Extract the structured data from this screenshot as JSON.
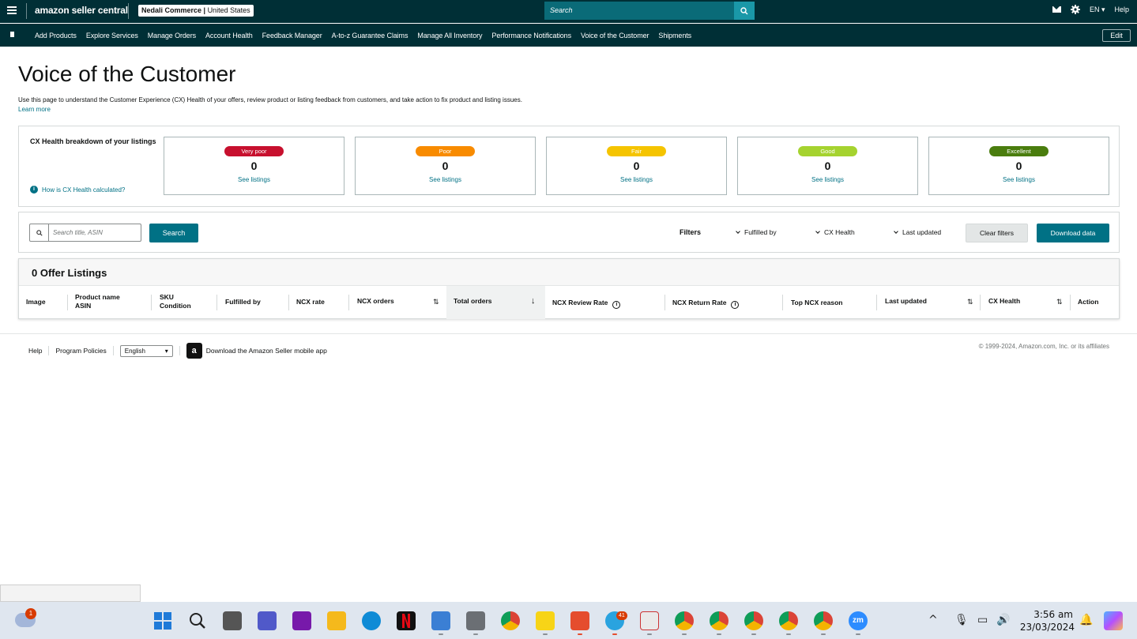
{
  "topbar": {
    "brand": "amazon seller central",
    "store_name": "Nedali Commerce",
    "store_region": "United States",
    "search_placeholder": "Search",
    "language": "EN",
    "help": "Help"
  },
  "nav": {
    "items": [
      "Add Products",
      "Explore Services",
      "Manage Orders",
      "Account Health",
      "Feedback Manager",
      "A-to-z Guarantee Claims",
      "Manage All Inventory",
      "Performance Notifications",
      "Voice of the Customer",
      "Shipments"
    ],
    "edit_label": "Edit"
  },
  "page": {
    "title": "Voice of the Customer",
    "intro": "Use this page to understand the Customer Experience (CX) Health of your offers, review product or listing feedback from customers, and take action to fix product and listing issues.",
    "learn_more": "Learn more"
  },
  "cx": {
    "label": "CX Health breakdown of your listings",
    "howto": "How is CX Health calculated?",
    "cards": [
      {
        "label": "Very poor",
        "count": "0",
        "link": "See listings",
        "color": "#c7102e"
      },
      {
        "label": "Poor",
        "count": "0",
        "link": "See listings",
        "color": "#f88b00"
      },
      {
        "label": "Fair",
        "count": "0",
        "link": "See listings",
        "color": "#f5c400"
      },
      {
        "label": "Good",
        "count": "0",
        "link": "See listings",
        "color": "#a5d32f"
      },
      {
        "label": "Excellent",
        "count": "0",
        "link": "See listings",
        "color": "#4a7d0e"
      }
    ]
  },
  "filters": {
    "search_placeholder": "Search title, ASIN",
    "search_button": "Search",
    "label": "Filters",
    "fulfilled_by": "Fulfilled by",
    "cx_health": "CX Health",
    "last_updated": "Last updated",
    "clear": "Clear filters",
    "download": "Download data"
  },
  "listings": {
    "heading": "0 Offer Listings",
    "columns": {
      "image": "Image",
      "product_name": "Product name",
      "asin": "ASIN",
      "sku": "SKU",
      "condition": "Condition",
      "fulfilled_by": "Fulfilled by",
      "ncx_rate": "NCX rate",
      "ncx_orders": "NCX orders",
      "total_orders": "Total orders",
      "ncx_review_rate": "NCX Review Rate",
      "ncx_return_rate": "NCX Return Rate",
      "top_ncx_reason": "Top NCX reason",
      "last_updated": "Last updated",
      "cx_health": "CX Health",
      "action": "Action"
    }
  },
  "footer": {
    "help": "Help",
    "policies": "Program Policies",
    "language": "English",
    "app": "Download the Amazon Seller mobile app",
    "copyright": "© 1999-2024, Amazon.com, Inc. or its affiliates"
  },
  "taskbar": {
    "weather_badge": "1",
    "telegram_badge": "41",
    "time": "3:56 am",
    "date": "23/03/2024"
  }
}
